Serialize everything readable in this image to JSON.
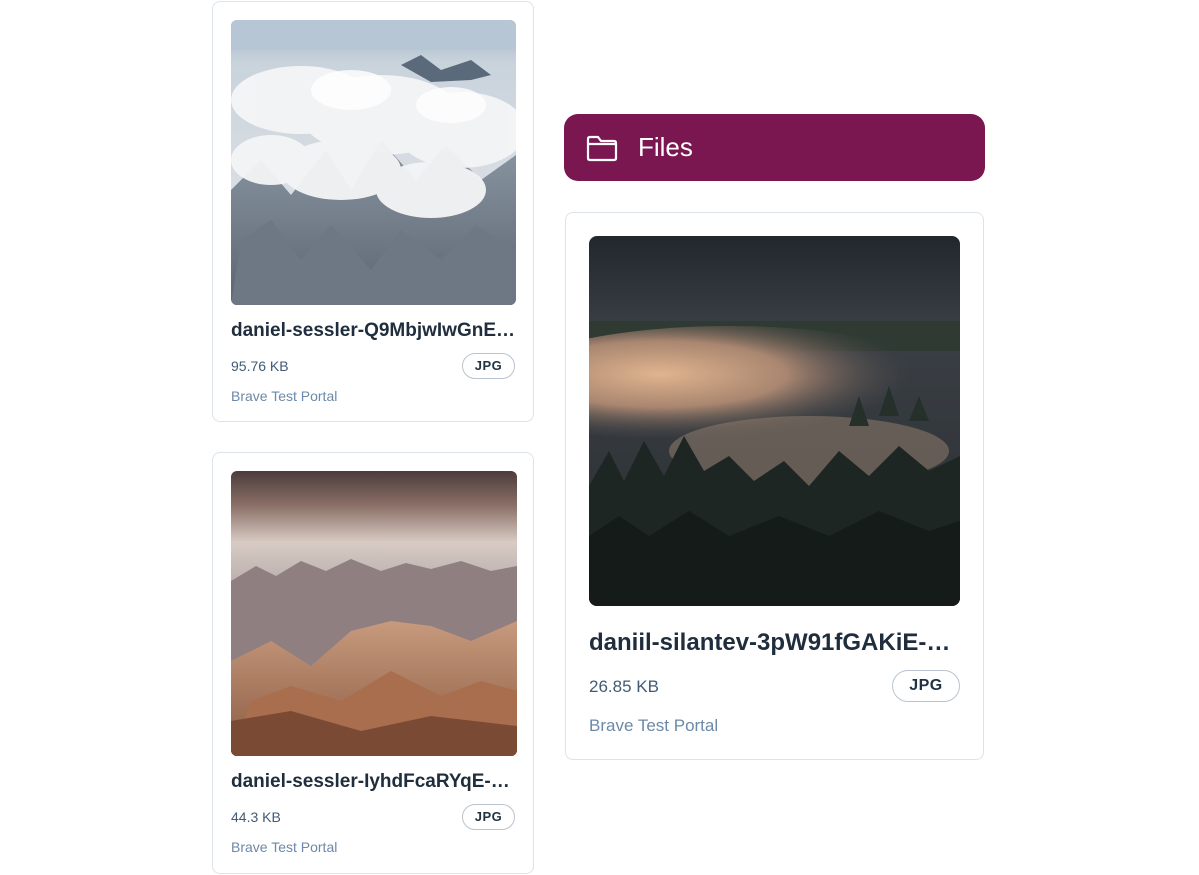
{
  "header": {
    "title": "Files",
    "icon": "folder-icon",
    "background": "#7a1750"
  },
  "files": [
    {
      "name": "daniel-sessler-Q9MbjwIwGnE-...",
      "size": "95.76 KB",
      "type": "JPG",
      "portal": "Brave Test Portal"
    },
    {
      "name": "daniel-sessler-IyhdFcaRYqE-u...",
      "size": "44.3 KB",
      "type": "JPG",
      "portal": "Brave Test Portal"
    },
    {
      "name": "daniil-silantev-3pW91fGAKiE-u...",
      "size": "26.85 KB",
      "type": "JPG",
      "portal": "Brave Test Portal"
    }
  ]
}
